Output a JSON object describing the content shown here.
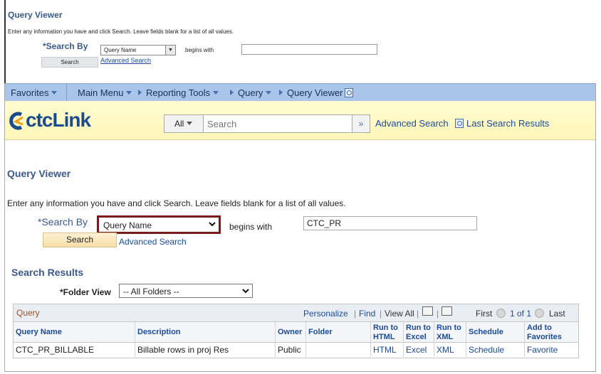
{
  "preview": {
    "title": "Query Viewer",
    "instructions": "Enter any information you have and click Search. Leave fields blank for a list of all values.",
    "search_by_label": "*Search By",
    "search_by_value": "Query Name",
    "begins_with": "begins with",
    "search_button": "Search",
    "advanced_search": "Advanced Search"
  },
  "nav": {
    "favorites": "Favorites",
    "main_menu": "Main Menu",
    "reporting_tools": "Reporting Tools",
    "query": "Query",
    "query_viewer": "Query Viewer"
  },
  "banner": {
    "logo_text": "ctcLink",
    "search_scope": "All",
    "search_placeholder": "Search",
    "advanced_search": "Advanced Search",
    "last_search_results": "Last Search Results"
  },
  "page": {
    "title": "Query Viewer",
    "instructions": "Enter any information you have and click Search. Leave fields blank for a list of all values.",
    "search_by_label": "*Search By",
    "search_by_value": "Query Name",
    "begins_with_label": "begins with",
    "begins_with_value": "CTC_PR",
    "search_button": "Search",
    "advanced_search": "Advanced Search",
    "search_results_title": "Search Results",
    "folder_view_label": "*Folder View",
    "folder_view_value": "-- All Folders --"
  },
  "grid": {
    "title": "Query",
    "personalize": "Personalize",
    "find": "Find",
    "view_all": "View All",
    "first": "First",
    "pager": "1 of 1",
    "last": "Last",
    "columns": [
      "Query Name",
      "Description",
      "Owner",
      "Folder",
      "Run to HTML",
      "Run to Excel",
      "Run to XML",
      "Schedule",
      "Add to Favorites"
    ],
    "rows": [
      {
        "query_name": "CTC_PR_BILLABLE",
        "description": "Billable rows in proj Res",
        "owner": "Public",
        "folder": "",
        "html": "HTML",
        "excel": "Excel",
        "xml": "XML",
        "schedule": "Schedule",
        "favorite": "Favorite"
      }
    ]
  },
  "colors": {
    "nav_bg": "#a9c6ea",
    "banner_bg": "#fff7b8",
    "highlight_border": "#7a1a1a",
    "link": "#1a4b9b",
    "title": "#3b5a8c"
  }
}
